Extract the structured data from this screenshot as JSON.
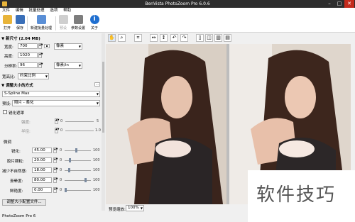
{
  "window": {
    "title": "BenVista PhotoZoom Pro 6.0.6",
    "minimize": "–",
    "maximize": "□",
    "close": "✕"
  },
  "menu": [
    "文件",
    "编辑",
    "批量处理",
    "选项",
    "帮助"
  ],
  "toolbar": {
    "open": "打开",
    "save": "保存",
    "batch": "新建批量处理",
    "preset": "预设",
    "settings": "参数设置",
    "about": "关于"
  },
  "left": {
    "new_size_header": "▼ 新尺寸 (2.04 MB)",
    "width_label": "宽度:",
    "width_value": "700",
    "height_label": "高度:",
    "height_value": "1020",
    "unit_px": "像素",
    "res_label": "分辨率:",
    "res_value": "96",
    "res_unit": "像素/in",
    "ratio_label": "宽高比:",
    "ratio_value": "约束比例",
    "method_header": "▼ 调整大小的方式",
    "method_value": "S-Spline Max",
    "preset_label": "预设:",
    "preset_value": "照片 - 柔化",
    "sharpen_check_label": "锐化遮罩",
    "strength_label": "强度:",
    "strength_tick_low": "0",
    "strength_tick_high": "5",
    "radius_label": "半径:",
    "radius_tick_low": "0",
    "radius_tick_high": "1.0",
    "fine_label": "微调",
    "sharpness_label": "锐化:",
    "sharpness_value": "45.00",
    "film_label": "胶片颗粒:",
    "film_value": "20.00",
    "artifact_label": "减少不自然感:",
    "artifact_value": "18.00",
    "smooth_label": "渐晕度:",
    "smooth_value": "80.00",
    "vibrance_label": "鲜艳度:",
    "vibrance_value": "0.00",
    "slider_low": "0",
    "slider_high": "100",
    "adjust_button": "调整大小配置文件...",
    "status": "PhotoZoom Pro 6"
  },
  "bottom": {
    "preview_label": "预览缩放:",
    "zoom_value": "100%"
  },
  "watermark": "软件技巧",
  "colors": {
    "titlebar": "#2d2d2d",
    "panel": "#f0f0f0",
    "accent": "#3a78d6"
  }
}
